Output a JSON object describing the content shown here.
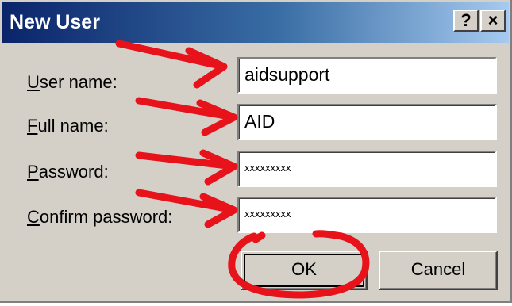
{
  "window": {
    "title": "New User",
    "help_label": "?",
    "close_label": "×"
  },
  "form": {
    "username_label_u": "U",
    "username_label_rest": "ser name:",
    "fullname_label_u": "F",
    "fullname_label_rest": "ull name:",
    "password_label_u": "P",
    "password_label_rest": "assword:",
    "confirm_label_u": "C",
    "confirm_label_rest": "onfirm password:",
    "username_value": "aidsupport",
    "fullname_value": "AID",
    "password_value": "xxxxxxxxx",
    "confirm_value": "xxxxxxxxx"
  },
  "buttons": {
    "ok_label": "OK",
    "cancel_label": "Cancel"
  },
  "colors": {
    "annotation": "#e8121a",
    "titlebar_start": "#0a246a"
  }
}
